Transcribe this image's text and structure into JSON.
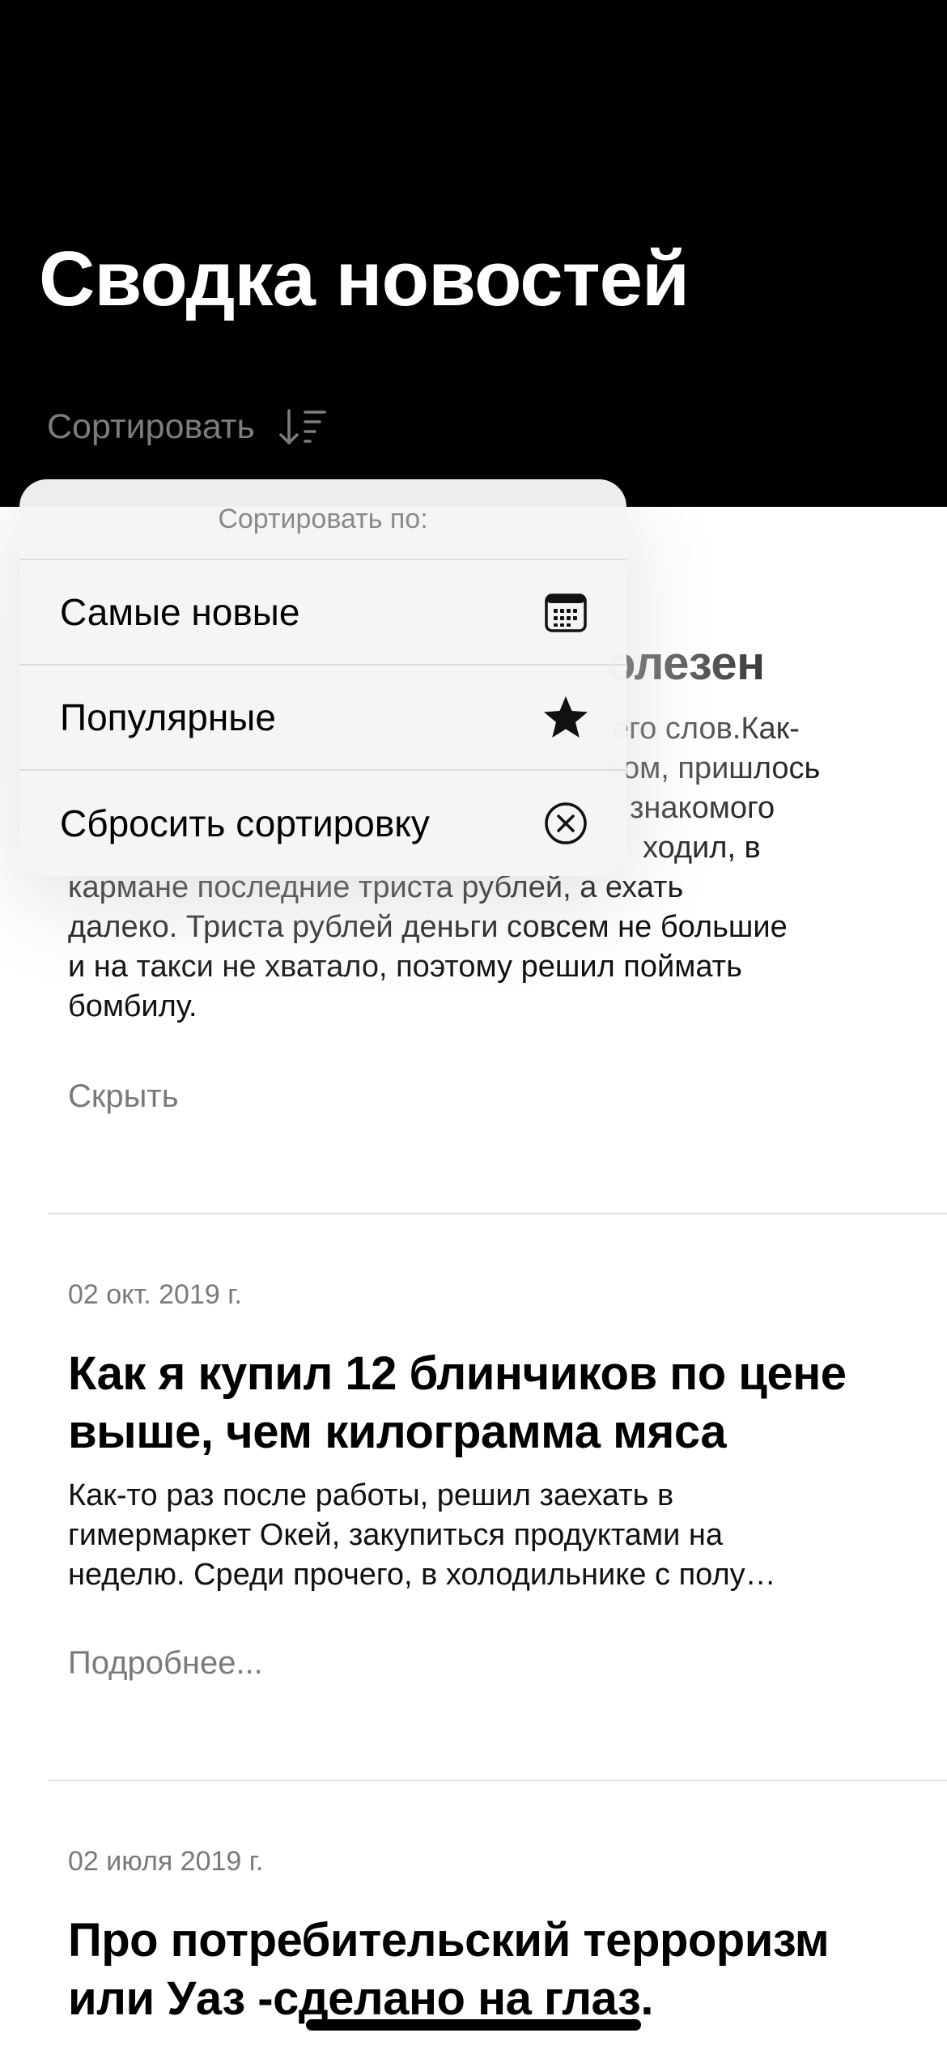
{
  "header": {
    "title": "Сводка новостей",
    "sort_label": "Сортировать",
    "sort_icon": "sort-descending-icon"
  },
  "articles": [
    {
      "title_partial": "олезен",
      "body_lines": [
        "его слов.Как-",
        "том, пришлось",
        "знакомого",
        "ходил, в",
        "кармане последние триста рублей, а ехать",
        "далеко. Триста рублей деньги совсем не большие",
        "и на такси не хватало, поэтому решил поймать",
        "бомбилу."
      ],
      "link": "Скрыть"
    },
    {
      "date": "02 окт. 2019 г.",
      "title_lines": [
        "Как я купил 12 блинчиков по цене",
        "выше, чем килограмма мяса"
      ],
      "body_lines": [
        "Как-то раз после работы, решил заехать в",
        "гимермаркет Окей, закупиться продуктами на",
        "неделю. Среди прочего, в холодильнике с полу…"
      ],
      "link": "Подробнее..."
    },
    {
      "date": "02 июля 2019 г.",
      "title_lines": [
        "Про потребительский терроризм",
        "или Уаз -сделано на глаз."
      ]
    }
  ],
  "sort_menu": {
    "header": "Сортировать по:",
    "items": [
      {
        "label": "Самые новые",
        "icon": "calendar-icon"
      },
      {
        "label": "Популярные",
        "icon": "star-icon"
      },
      {
        "label": "Сбросить сортировку",
        "icon": "close-circle-icon"
      }
    ]
  }
}
